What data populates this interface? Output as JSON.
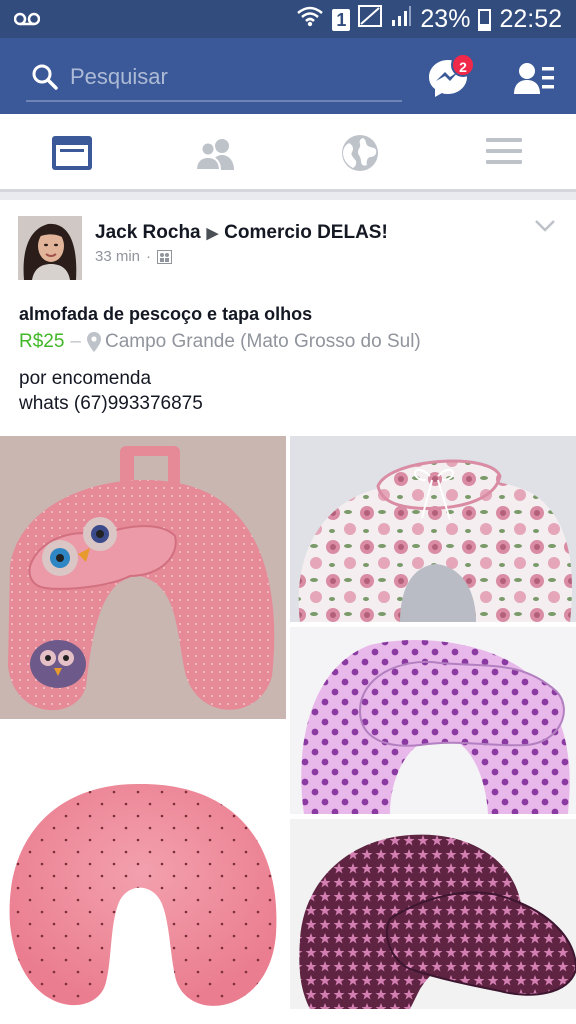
{
  "status_bar": {
    "battery": "23%",
    "time": "22:52",
    "sim_label": "1"
  },
  "search": {
    "placeholder": "Pesquisar"
  },
  "messenger": {
    "badge_count": "2"
  },
  "tabs": [
    {
      "name": "news-feed",
      "active": true
    },
    {
      "name": "friends",
      "active": false
    },
    {
      "name": "notifications-globe",
      "active": false
    },
    {
      "name": "menu",
      "active": false
    }
  ],
  "post": {
    "author": "Jack Rocha",
    "group": "Comercio DELAS!",
    "time": "33 min",
    "title": "almofada de pescoço e tapa olhos",
    "price": "R$25",
    "separator": "–",
    "location": "Campo Grande (Mato Grosso do Sul)",
    "body_line1": "por encomenda",
    "body_line2": "whats (67)993376875",
    "photos": [
      {
        "name": "pink-owl-neck-pillow"
      },
      {
        "name": "floral-neck-pillow"
      },
      {
        "name": "lilac-polka-dot-neck-pillow"
      },
      {
        "name": "pink-dotted-neck-pillow"
      },
      {
        "name": "purple-star-neck-pillow"
      }
    ]
  },
  "colors": {
    "brand_blue": "#3b5998",
    "status_blue": "#324c7e",
    "price_green": "#42b72a",
    "badge_red": "#f02849"
  }
}
